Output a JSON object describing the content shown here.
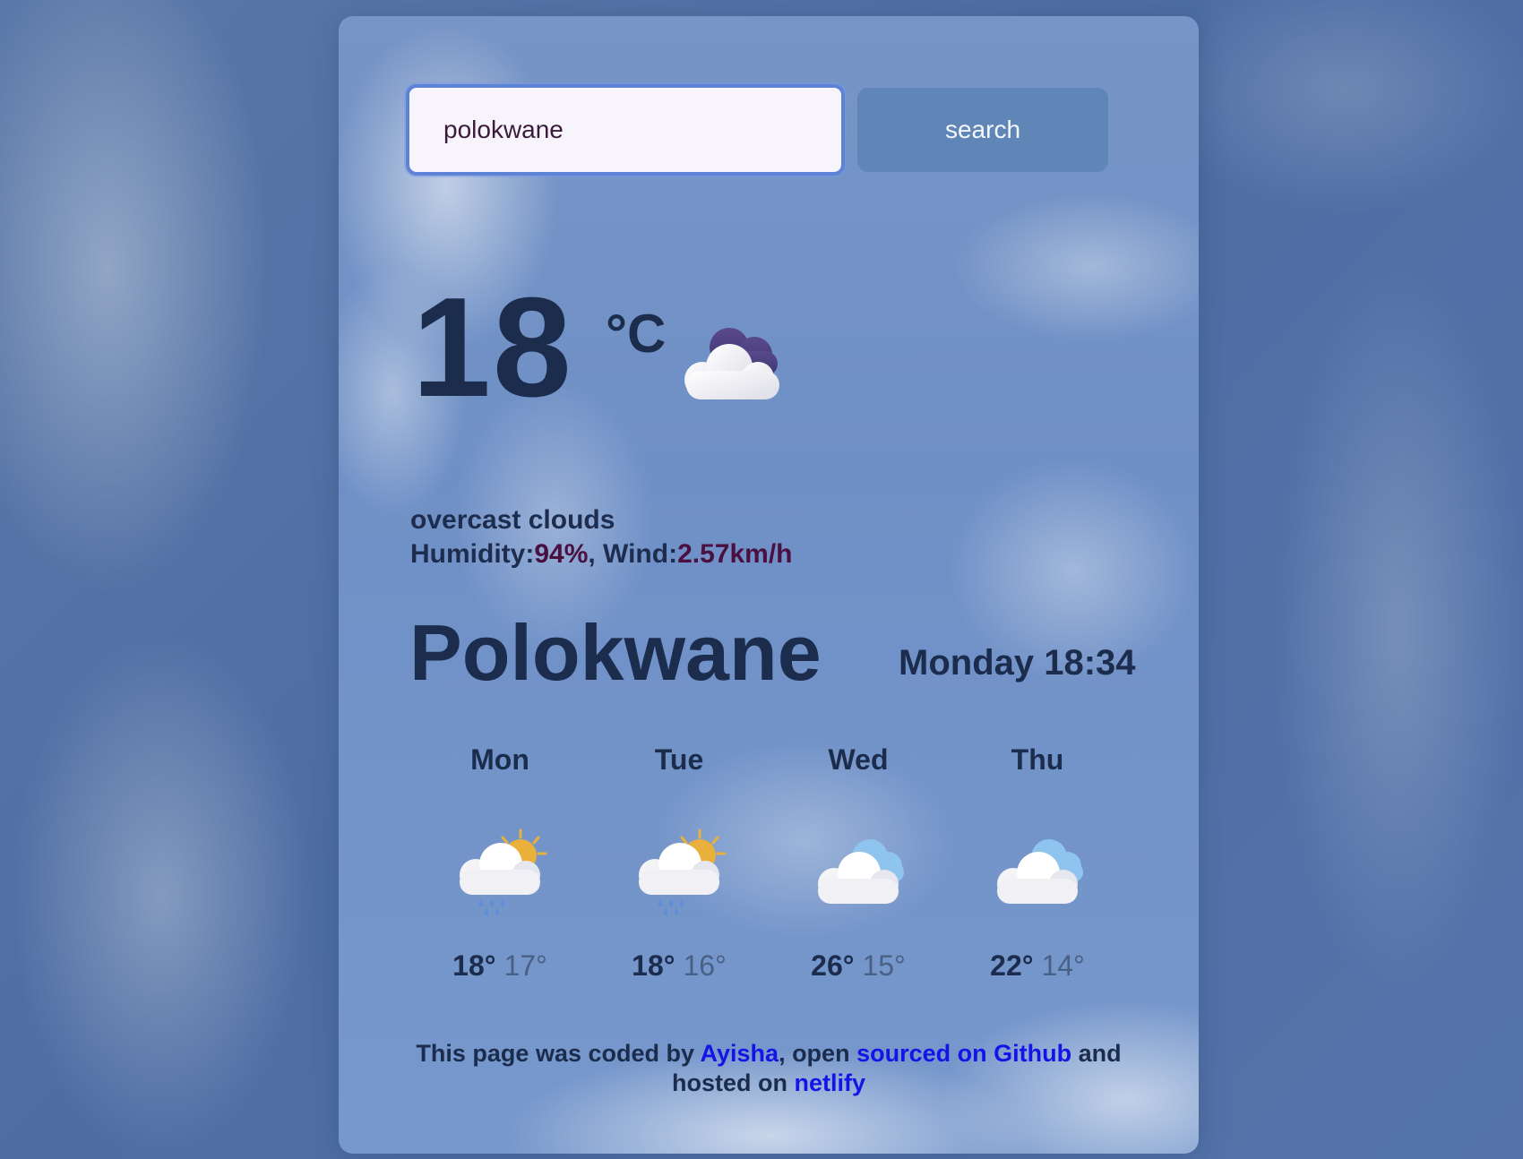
{
  "search": {
    "value": "polokwane",
    "button_label": "search"
  },
  "current": {
    "temperature": "18",
    "unit": "°C",
    "icon": "overcast-cloud-icon",
    "description": "overcast clouds",
    "humidity_label": "Humidity:",
    "humidity_value": "94%",
    "wind_label": ", Wind:",
    "wind_value": "2.57km/h"
  },
  "location": {
    "city": "Polokwane",
    "datetime": "Monday 18:34"
  },
  "forecast": [
    {
      "day": "Mon",
      "icon": "sun-cloud-rain-icon",
      "max": "18°",
      "min": "17°"
    },
    {
      "day": "Tue",
      "icon": "sun-cloud-rain-icon",
      "max": "18°",
      "min": "16°"
    },
    {
      "day": "Wed",
      "icon": "cloudy-icon",
      "max": "26°",
      "min": "15°"
    },
    {
      "day": "Thu",
      "icon": "cloudy-icon",
      "max": "22°",
      "min": "14°"
    }
  ],
  "footer": {
    "text1": "This page was coded by ",
    "link_author": "Ayisha",
    "text2": ", open ",
    "link_github": "sourced on Github",
    "text3": " and hosted on ",
    "link_host": "netlify"
  },
  "colors": {
    "link": "#1414e6",
    "highlight": "#4a1040",
    "text": "#1b2c4d"
  }
}
